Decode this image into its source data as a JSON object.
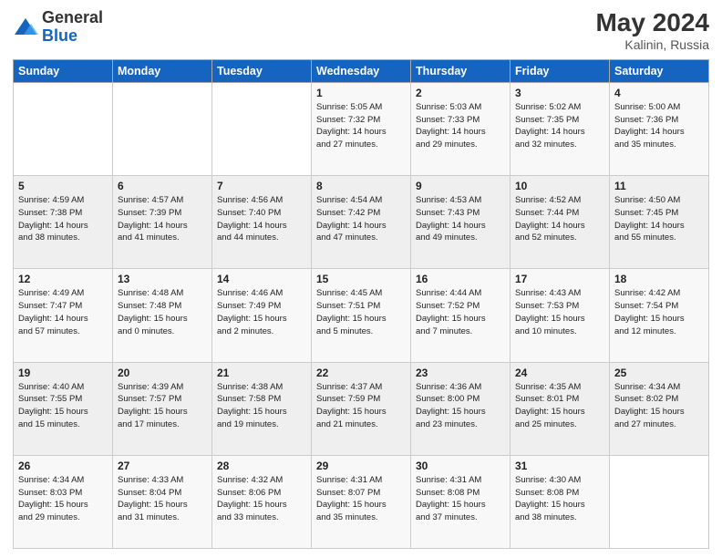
{
  "header": {
    "logo_general": "General",
    "logo_blue": "Blue",
    "month_year": "May 2024",
    "location": "Kalinin, Russia"
  },
  "weekdays": [
    "Sunday",
    "Monday",
    "Tuesday",
    "Wednesday",
    "Thursday",
    "Friday",
    "Saturday"
  ],
  "weeks": [
    [
      {
        "day": "",
        "info": ""
      },
      {
        "day": "",
        "info": ""
      },
      {
        "day": "",
        "info": ""
      },
      {
        "day": "1",
        "info": "Sunrise: 5:05 AM\nSunset: 7:32 PM\nDaylight: 14 hours\nand 27 minutes."
      },
      {
        "day": "2",
        "info": "Sunrise: 5:03 AM\nSunset: 7:33 PM\nDaylight: 14 hours\nand 29 minutes."
      },
      {
        "day": "3",
        "info": "Sunrise: 5:02 AM\nSunset: 7:35 PM\nDaylight: 14 hours\nand 32 minutes."
      },
      {
        "day": "4",
        "info": "Sunrise: 5:00 AM\nSunset: 7:36 PM\nDaylight: 14 hours\nand 35 minutes."
      }
    ],
    [
      {
        "day": "5",
        "info": "Sunrise: 4:59 AM\nSunset: 7:38 PM\nDaylight: 14 hours\nand 38 minutes."
      },
      {
        "day": "6",
        "info": "Sunrise: 4:57 AM\nSunset: 7:39 PM\nDaylight: 14 hours\nand 41 minutes."
      },
      {
        "day": "7",
        "info": "Sunrise: 4:56 AM\nSunset: 7:40 PM\nDaylight: 14 hours\nand 44 minutes."
      },
      {
        "day": "8",
        "info": "Sunrise: 4:54 AM\nSunset: 7:42 PM\nDaylight: 14 hours\nand 47 minutes."
      },
      {
        "day": "9",
        "info": "Sunrise: 4:53 AM\nSunset: 7:43 PM\nDaylight: 14 hours\nand 49 minutes."
      },
      {
        "day": "10",
        "info": "Sunrise: 4:52 AM\nSunset: 7:44 PM\nDaylight: 14 hours\nand 52 minutes."
      },
      {
        "day": "11",
        "info": "Sunrise: 4:50 AM\nSunset: 7:45 PM\nDaylight: 14 hours\nand 55 minutes."
      }
    ],
    [
      {
        "day": "12",
        "info": "Sunrise: 4:49 AM\nSunset: 7:47 PM\nDaylight: 14 hours\nand 57 minutes."
      },
      {
        "day": "13",
        "info": "Sunrise: 4:48 AM\nSunset: 7:48 PM\nDaylight: 15 hours\nand 0 minutes."
      },
      {
        "day": "14",
        "info": "Sunrise: 4:46 AM\nSunset: 7:49 PM\nDaylight: 15 hours\nand 2 minutes."
      },
      {
        "day": "15",
        "info": "Sunrise: 4:45 AM\nSunset: 7:51 PM\nDaylight: 15 hours\nand 5 minutes."
      },
      {
        "day": "16",
        "info": "Sunrise: 4:44 AM\nSunset: 7:52 PM\nDaylight: 15 hours\nand 7 minutes."
      },
      {
        "day": "17",
        "info": "Sunrise: 4:43 AM\nSunset: 7:53 PM\nDaylight: 15 hours\nand 10 minutes."
      },
      {
        "day": "18",
        "info": "Sunrise: 4:42 AM\nSunset: 7:54 PM\nDaylight: 15 hours\nand 12 minutes."
      }
    ],
    [
      {
        "day": "19",
        "info": "Sunrise: 4:40 AM\nSunset: 7:55 PM\nDaylight: 15 hours\nand 15 minutes."
      },
      {
        "day": "20",
        "info": "Sunrise: 4:39 AM\nSunset: 7:57 PM\nDaylight: 15 hours\nand 17 minutes."
      },
      {
        "day": "21",
        "info": "Sunrise: 4:38 AM\nSunset: 7:58 PM\nDaylight: 15 hours\nand 19 minutes."
      },
      {
        "day": "22",
        "info": "Sunrise: 4:37 AM\nSunset: 7:59 PM\nDaylight: 15 hours\nand 21 minutes."
      },
      {
        "day": "23",
        "info": "Sunrise: 4:36 AM\nSunset: 8:00 PM\nDaylight: 15 hours\nand 23 minutes."
      },
      {
        "day": "24",
        "info": "Sunrise: 4:35 AM\nSunset: 8:01 PM\nDaylight: 15 hours\nand 25 minutes."
      },
      {
        "day": "25",
        "info": "Sunrise: 4:34 AM\nSunset: 8:02 PM\nDaylight: 15 hours\nand 27 minutes."
      }
    ],
    [
      {
        "day": "26",
        "info": "Sunrise: 4:34 AM\nSunset: 8:03 PM\nDaylight: 15 hours\nand 29 minutes."
      },
      {
        "day": "27",
        "info": "Sunrise: 4:33 AM\nSunset: 8:04 PM\nDaylight: 15 hours\nand 31 minutes."
      },
      {
        "day": "28",
        "info": "Sunrise: 4:32 AM\nSunset: 8:06 PM\nDaylight: 15 hours\nand 33 minutes."
      },
      {
        "day": "29",
        "info": "Sunrise: 4:31 AM\nSunset: 8:07 PM\nDaylight: 15 hours\nand 35 minutes."
      },
      {
        "day": "30",
        "info": "Sunrise: 4:31 AM\nSunset: 8:08 PM\nDaylight: 15 hours\nand 37 minutes."
      },
      {
        "day": "31",
        "info": "Sunrise: 4:30 AM\nSunset: 8:08 PM\nDaylight: 15 hours\nand 38 minutes."
      },
      {
        "day": "",
        "info": ""
      }
    ]
  ]
}
